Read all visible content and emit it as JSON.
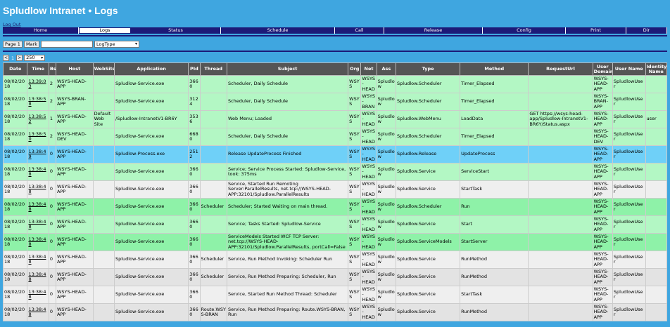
{
  "header": {
    "title": "Spludlow Intranet • Logs",
    "logout": "Log Out"
  },
  "nav": [
    {
      "label": "Home",
      "active": false
    },
    {
      "label": "Logs",
      "active": true
    },
    {
      "label": "Status",
      "active": false
    },
    {
      "label": "Schedule",
      "active": false
    },
    {
      "label": "Call",
      "active": false
    },
    {
      "label": "Release",
      "active": false
    },
    {
      "label": "Config",
      "active": false
    },
    {
      "label": "Print",
      "active": false
    },
    {
      "label": "Dir",
      "active": false
    }
  ],
  "toolbar": {
    "page_button": "Page 1",
    "mark_button": "Mark",
    "filter_value": "",
    "logtype_select": "LogType"
  },
  "pager": {
    "prev": "<",
    "current": "1",
    "next": ">",
    "page_size": "250"
  },
  "table": {
    "columns": [
      "Date",
      "Time",
      "Bs",
      "Host",
      "WebSite",
      "Application",
      "PId",
      "Thread",
      "Subject",
      "Org",
      "Net",
      "Ass",
      "Type",
      "Method",
      "RequestUrl",
      "User Domain",
      "User Name",
      "Identity Name"
    ],
    "rows": [
      {
        "date": "08/02/2018",
        "time": "13:39:03",
        "bs": "2",
        "host": "WSYS-HEAD-APP",
        "website": "",
        "application": "Spludlow-Service.exe",
        "pid": "3660",
        "thread": "",
        "subject": "Scheduler, Daily Schedule",
        "org": "WSYS",
        "net": "WSYS-HEAD",
        "ass": "Spludlow",
        "type": "Spludlow.Scheduler",
        "method": "Timer_Elapsed",
        "requesturl": "",
        "userdomain": "WSYS-HEAD-APP",
        "username": "SpludlowUser",
        "identity": ""
      },
      {
        "date": "08/02/2018",
        "time": "13:38:58",
        "bs": "2",
        "host": "WSYS-BRAN-APP",
        "website": "",
        "application": "Spludlow-Service.exe",
        "pid": "3124",
        "thread": "",
        "subject": "Scheduler, Daily Schedule",
        "org": "WSYS",
        "net": "WSYS-BRAN",
        "ass": "Spludlow",
        "type": "Spludlow.Scheduler",
        "method": "Timer_Elapsed",
        "requesturl": "",
        "userdomain": "WSYS-BRAN-APP",
        "username": "SpludlowUser",
        "identity": ""
      },
      {
        "date": "08/02/2018",
        "time": "13:38:52",
        "bs": "1",
        "host": "WSYS-HEAD-APP",
        "website": "Default Web Site",
        "application": "/Spludlow-IntranetV1-BR6Y",
        "pid": "3536",
        "thread": "",
        "subject": "Web Menu; Loaded",
        "org": "WSYS",
        "net": "WSYS-HEAD",
        "ass": "Spludlow",
        "type": "Spludlow.WebMenu",
        "method": "LoadData",
        "requesturl": "GET https://wsys-head-app/Spludlow-IntranetV1-BR6Y/Status.aspx",
        "userdomain": "WSYS-HEAD-APP",
        "username": "SpludlowUser",
        "identity": "user"
      },
      {
        "date": "08/02/2018",
        "time": "13:38:50",
        "bs": "2",
        "host": "WSYS-HEAD-DEV",
        "website": "",
        "application": "Spludlow-Service.exe",
        "pid": "6680",
        "thread": "",
        "subject": "Scheduler, Daily Schedule",
        "org": "WSYS",
        "net": "WSYS-HEAD",
        "ass": "Spludlow",
        "type": "Spludlow.Scheduler",
        "method": "Timer_Elapsed",
        "requesturl": "",
        "userdomain": "WSYS-HEAD-DEV",
        "username": "SpludlowUser",
        "identity": ""
      },
      {
        "date": "08/02/2018",
        "time": "13:38:49",
        "bs": "0",
        "host": "WSYS-HEAD-APP",
        "website": "",
        "application": "Spludlow-Process.exe",
        "pid": "2512",
        "thread": "",
        "subject": "Release UpdateProcess Finished",
        "org": "WSYS",
        "net": "WSYS-HEAD",
        "ass": "Spludlow",
        "type": "Spludlow.Release",
        "method": "UpdateProcess",
        "requesturl": "",
        "userdomain": "WSYS-HEAD-APP",
        "username": "SpludlowUser",
        "identity": ""
      },
      {
        "date": "08/02/2018",
        "time": "13:38:48",
        "bs": "0",
        "host": "WSYS-HEAD-APP",
        "website": "",
        "application": "Spludlow-Service.exe",
        "pid": "3660",
        "thread": "",
        "subject": "Service; Service Process Started: Spludlow-Service, took: 375ms",
        "org": "WSYS",
        "net": "WSYS-HEAD",
        "ass": "Spludlow",
        "type": "Spludlow.Service",
        "method": "ServiceStart",
        "requesturl": "",
        "userdomain": "WSYS-HEAD-APP",
        "username": "SpludlowUser",
        "identity": ""
      },
      {
        "date": "08/02/2018",
        "time": "13:38:48",
        "bs": "0",
        "host": "WSYS-HEAD-APP",
        "website": "",
        "application": "Spludlow-Service.exe",
        "pid": "3660",
        "thread": "",
        "subject": "Service, Started Run Remoting Server:ParallelResults, net.tcp://WSYS-HEAD-APP:32101/Spludlow.ParallelResults",
        "org": "WSYS",
        "net": "WSYS-HEAD",
        "ass": "Spludlow",
        "type": "Spludlow.Service",
        "method": "StartTask",
        "requesturl": "",
        "userdomain": "WSYS-HEAD-APP",
        "username": "SpludlowUser",
        "identity": ""
      },
      {
        "date": "08/02/2018",
        "time": "13:38:48",
        "bs": "0",
        "host": "WSYS-HEAD-APP",
        "website": "",
        "application": "Spludlow-Service.exe",
        "pid": "3660",
        "thread": "Scheduler",
        "subject": "Scheduler; Started Waiting on main thread.",
        "org": "WSYS",
        "net": "WSYS-HEAD",
        "ass": "Spludlow",
        "type": "Spludlow.Scheduler",
        "method": "Run",
        "requesturl": "",
        "userdomain": "WSYS-HEAD-APP",
        "username": "SpludlowUser",
        "identity": ""
      },
      {
        "date": "08/02/2018",
        "time": "13:38:48",
        "bs": "0",
        "host": "WSYS-HEAD-APP",
        "website": "",
        "application": "Spludlow-Service.exe",
        "pid": "3660",
        "thread": "",
        "subject": "Service; Tasks Started: Spludlow-Service",
        "org": "WSYS",
        "net": "WSYS-HEAD",
        "ass": "Spludlow",
        "type": "Spludlow.Service",
        "method": "Start",
        "requesturl": "",
        "userdomain": "WSYS-HEAD-APP",
        "username": "SpludlowUser",
        "identity": ""
      },
      {
        "date": "08/02/2018",
        "time": "13:38:48",
        "bs": "0",
        "host": "WSYS-HEAD-APP",
        "website": "",
        "application": "Spludlow-Service.exe",
        "pid": "3660",
        "thread": "",
        "subject": "ServiceModels Started WCF TCP Server: net.tcp://WSYS-HEAD-APP:32101/Spludlow.ParallelResults, portCall=False",
        "org": "WSYS",
        "net": "WSYS-HEAD",
        "ass": "Spludlow",
        "type": "Spludlow.ServiceModels",
        "method": "StartServer",
        "requesturl": "",
        "userdomain": "WSYS-HEAD-APP",
        "username": "SpludlowUser",
        "identity": ""
      },
      {
        "date": "08/02/2018",
        "time": "13:38:48",
        "bs": "0",
        "host": "WSYS-HEAD-APP",
        "website": "",
        "application": "Spludlow-Service.exe",
        "pid": "3660",
        "thread": "Scheduler",
        "subject": "Service, Run Method Invoking: Scheduler Run",
        "org": "WSYS",
        "net": "WSYS-HEAD",
        "ass": "Spludlow",
        "type": "Spludlow.Service",
        "method": "RunMethod",
        "requesturl": "",
        "userdomain": "WSYS-HEAD-APP",
        "username": "SpludlowUser",
        "identity": ""
      },
      {
        "date": "08/02/2018",
        "time": "13:38:48",
        "bs": "0",
        "host": "WSYS-HEAD-APP",
        "website": "",
        "application": "Spludlow-Service.exe",
        "pid": "3660",
        "thread": "Scheduler",
        "subject": "Service, Run Method Preparing: Scheduler, Run",
        "org": "WSYS",
        "net": "WSYS-HEAD",
        "ass": "Spludlow",
        "type": "Spludlow.Service",
        "method": "RunMethod",
        "requesturl": "",
        "userdomain": "WSYS-HEAD-APP",
        "username": "SpludlowUser",
        "identity": ""
      },
      {
        "date": "08/02/2018",
        "time": "13:38:48",
        "bs": "0",
        "host": "WSYS-HEAD-APP",
        "website": "",
        "application": "Spludlow-Service.exe",
        "pid": "3660",
        "thread": "",
        "subject": "Service, Started Run Method Thread: Scheduler",
        "org": "WSYS",
        "net": "WSYS-HEAD",
        "ass": "Spludlow",
        "type": "Spludlow.Service",
        "method": "StartTask",
        "requesturl": "",
        "userdomain": "WSYS-HEAD-APP",
        "username": "SpludlowUser",
        "identity": ""
      },
      {
        "date": "08/02/2018",
        "time": "13:38:48",
        "bs": "0",
        "host": "WSYS-HEAD-APP",
        "website": "",
        "application": "Spludlow-Service.exe",
        "pid": "3660",
        "thread": "Route.WSYS-BRAN",
        "subject": "Service, Run Method Preparing: Route.WSYS-BRAN, Run",
        "org": "WSYS",
        "net": "WSYS-HEAD",
        "ass": "Spludlow",
        "type": "Spludlow.Service",
        "method": "RunMethod",
        "requesturl": "",
        "userdomain": "WSYS-HEAD-APP",
        "username": "SpludlowUser",
        "identity": ""
      }
    ]
  }
}
